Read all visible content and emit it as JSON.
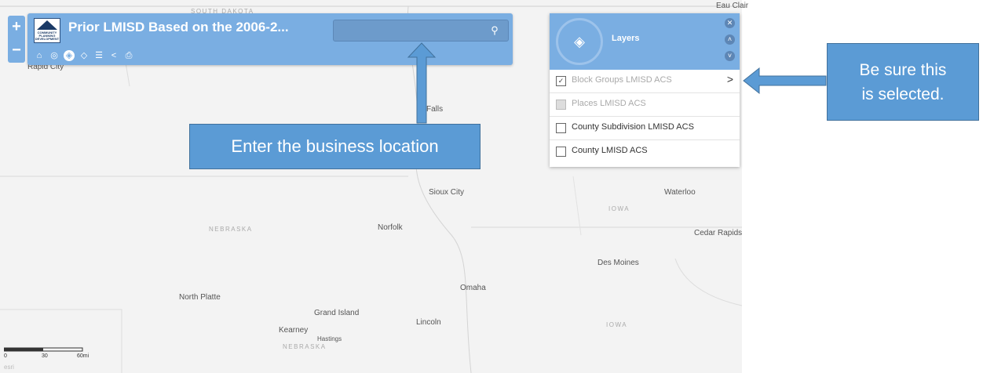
{
  "header": {
    "title": "Prior LMISD Based on the 2006-2...",
    "logo_text": "COMMUNITY PLANNING DEVELOPMENT"
  },
  "search": {
    "placeholder": "",
    "value": ""
  },
  "zoom": {
    "in": "+",
    "out": "−"
  },
  "icons": {
    "search": "search-icon",
    "home": "home-icon",
    "locate": "locate-icon",
    "layers": "layers-icon",
    "basemap": "basemap-icon",
    "legend": "legend-icon",
    "share": "share-icon",
    "print": "print-icon"
  },
  "layers_panel": {
    "title": "Layers",
    "items": [
      {
        "label": "Block Groups LMISD ACS",
        "checked": true,
        "dimmed": true,
        "has_arrow": true,
        "check_mark": "✓",
        "arrow": ">"
      },
      {
        "label": "Places LMISD ACS",
        "checked": false,
        "dimmed": true,
        "has_arrow": false
      },
      {
        "label": "County Subdivision LMISD ACS",
        "checked": false,
        "dimmed": false,
        "has_arrow": false
      },
      {
        "label": "County LMISD ACS",
        "checked": false,
        "dimmed": false,
        "has_arrow": false
      }
    ]
  },
  "map": {
    "places": {
      "rapid_city": "Rapid City",
      "sioux_falls": "Falls",
      "sioux_city": "Sioux City",
      "norfolk": "Norfolk",
      "waterloo": "Waterloo",
      "cedar_rapids": "Cedar Rapids",
      "des_moines": "Des Moines",
      "omaha": "Omaha",
      "north_platte": "North Platte",
      "grand_island": "Grand Island",
      "lincoln": "Lincoln",
      "kearney": "Kearney",
      "hastings": "Hastings",
      "eau_claire": "Eau Clair"
    },
    "states": {
      "south_dakota": "SOUTH DAKOTA",
      "nebraska_1": "NEBRASKA",
      "nebraska_2": "NEBRASKA",
      "iowa_1": "IOWA",
      "iowa_2": "IOWA"
    },
    "scale": {
      "zero": "0",
      "mid": "30",
      "end": "60mi"
    },
    "attribution": "esri"
  },
  "callouts": {
    "enter": "Enter the business location",
    "sure_line1": "Be sure this",
    "sure_line2": "is selected."
  },
  "colors": {
    "panel": "#7aaee2",
    "callout": "#5b9bd5",
    "callout_border": "#41719c",
    "map_bg": "#f3f3f3"
  }
}
